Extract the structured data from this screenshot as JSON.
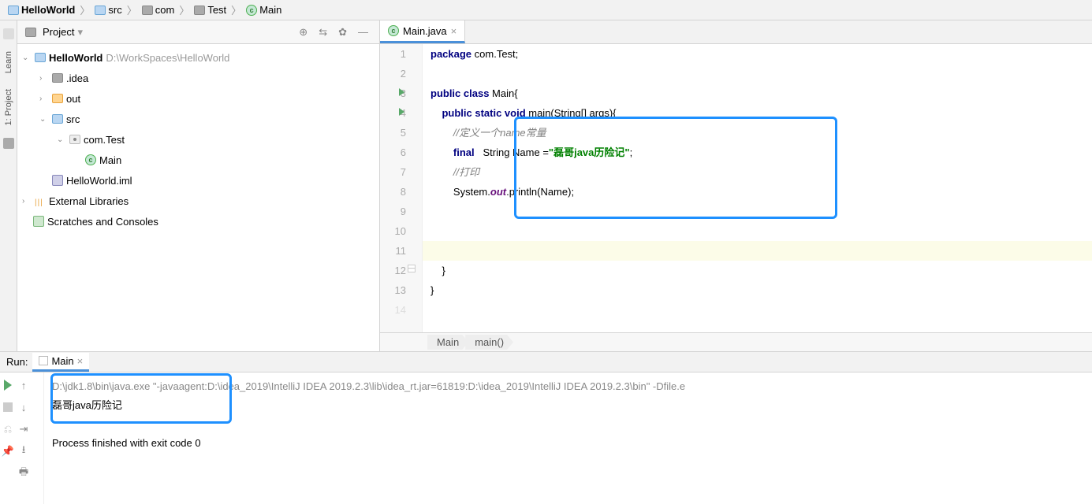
{
  "breadcrumb": {
    "items": [
      {
        "label": "HelloWorld",
        "icon": "module"
      },
      {
        "label": "src",
        "icon": "folder"
      },
      {
        "label": "com",
        "icon": "folder-dark"
      },
      {
        "label": "Test",
        "icon": "folder-dark"
      },
      {
        "label": "Main",
        "icon": "class"
      }
    ]
  },
  "left_tabs": {
    "learn": "Learn",
    "project": "1: Project"
  },
  "project_panel": {
    "title": "Project",
    "tree": {
      "root": {
        "name": "HelloWorld",
        "path": "D:\\WorkSpaces\\HelloWorld"
      },
      "idea": ".idea",
      "out": "out",
      "src": "src",
      "pkg": "com.Test",
      "main": "Main",
      "iml": "HelloWorld.iml",
      "ext": "External Libraries",
      "scratch": "Scratches and Consoles"
    }
  },
  "editor": {
    "tab_name": "Main.java",
    "lines": {
      "l1_a": "package",
      "l1_b": " com.Test;",
      "l3_a": "public class ",
      "l3_b": "Main{",
      "l4_a": "public static void ",
      "l4_b": "main(String[] args){",
      "l5": "//定义一个name常量",
      "l6_a": "final   ",
      "l6_b": "String Name =",
      "l6_c": "\"磊哥java历险记\"",
      "l6_d": ";",
      "l7": "//打印",
      "l8_a": "System.",
      "l8_b": "out",
      "l8_c": ".println(Name);",
      "l12": "    }",
      "l13": "}"
    },
    "crumbs": {
      "c1": "Main",
      "c2": "main()"
    }
  },
  "run": {
    "label": "Run:",
    "tab": "Main",
    "console": {
      "cmd": "D:\\jdk1.8\\bin\\java.exe \"-javaagent:D:\\idea_2019\\IntelliJ IDEA 2019.2.3\\lib\\idea_rt.jar=61819:D:\\idea_2019\\IntelliJ IDEA 2019.2.3\\bin\" -Dfile.e",
      "out": "磊哥java历险记",
      "exit": "Process finished with exit code 0"
    }
  }
}
